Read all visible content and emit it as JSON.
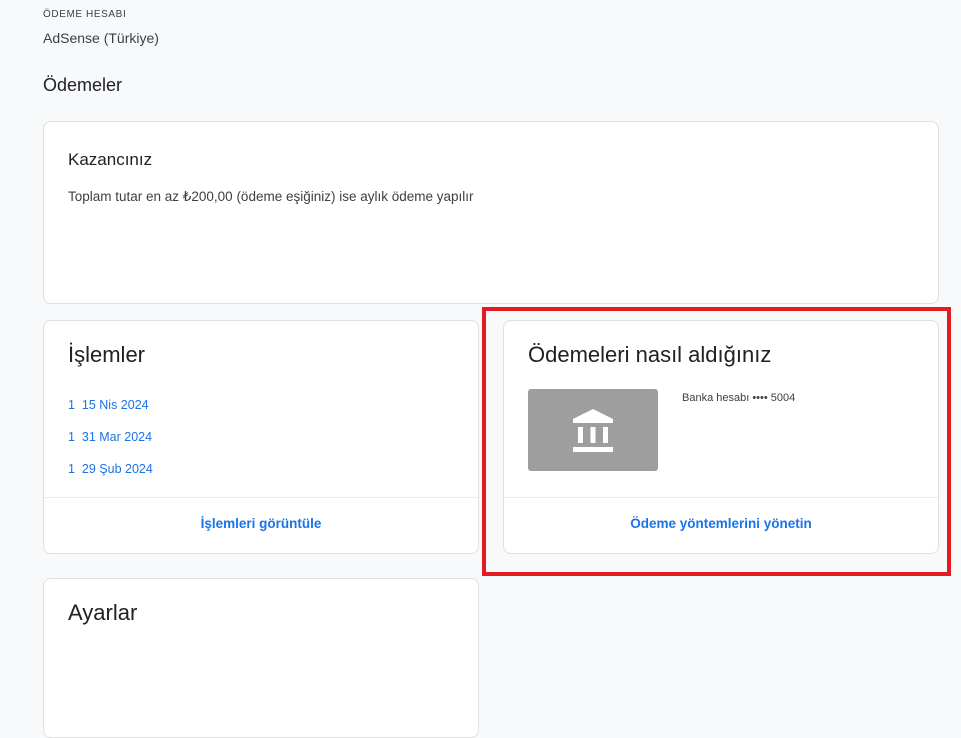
{
  "account": {
    "label": "ÖDEME HESABI",
    "name": "AdSense (Türkiye)"
  },
  "page_title": "Ödemeler",
  "earnings": {
    "title": "Kazancınız",
    "description": "Toplam tutar en az ₺200,00 (ödeme eşiğiniz) ise aylık ödeme yapılır"
  },
  "transactions": {
    "title": "İşlemler",
    "items": [
      {
        "label": "1  15 Nis 2024"
      },
      {
        "label": "1  31 Mar 2024"
      },
      {
        "label": "1  29 Şub 2024"
      }
    ],
    "action_label": "İşlemleri görüntüle"
  },
  "payment_method": {
    "title": "Ödemeleri nasıl aldığınız",
    "icon": "bank-icon",
    "bank_text": "Banka hesabı •••• 5004",
    "action_label": "Ödeme yöntemlerini yönetin"
  },
  "settings": {
    "title": "Ayarlar"
  },
  "colors": {
    "background": "#f8f9fa",
    "link": "#1a73e8",
    "highlight": "#e51b23",
    "bank_tile": "#9e9e9e"
  }
}
